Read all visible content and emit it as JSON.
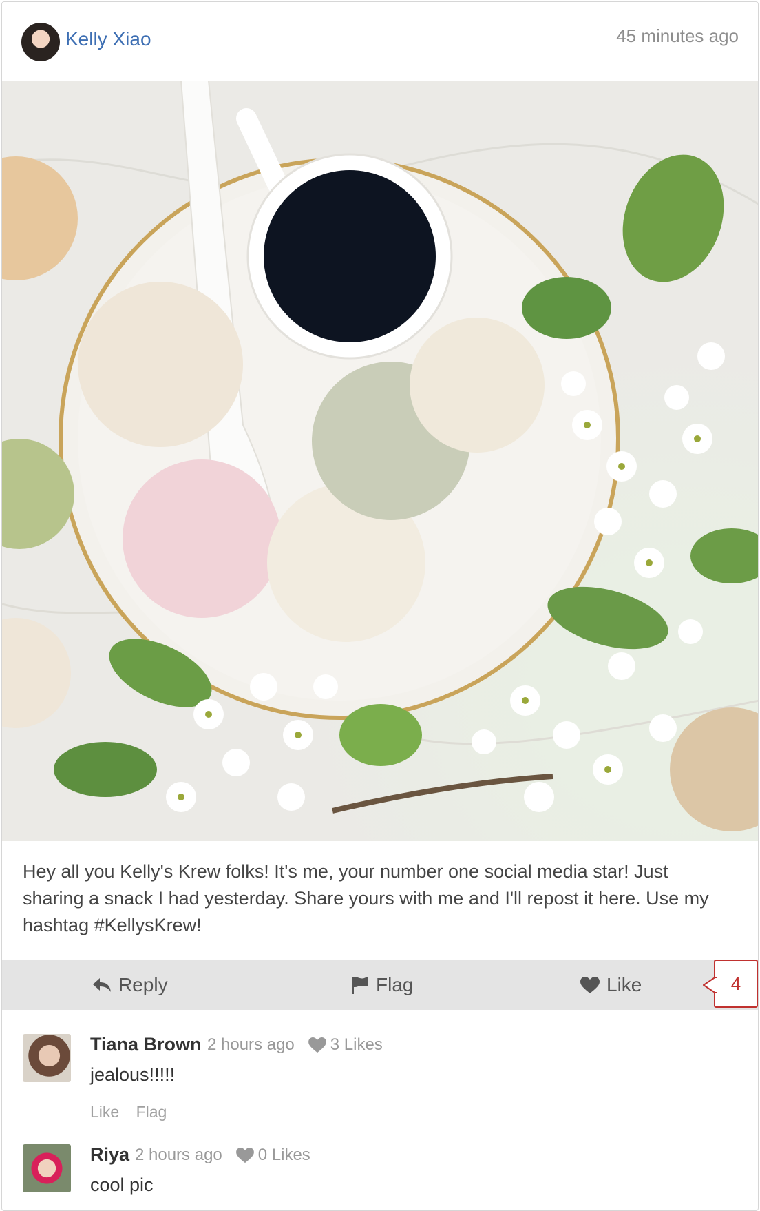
{
  "post": {
    "author": "Kelly Xiao",
    "time": "45 minutes ago",
    "caption": "Hey all you Kelly's Krew folks! It's me, your number one social media star! Just sharing a snack I had yesterday. Share yours with me and I'll repost it here. Use my hashtag #KellysKrew!",
    "actions": {
      "reply": "Reply",
      "flag": "Flag",
      "like": "Like",
      "like_count": "4"
    }
  },
  "comments": [
    {
      "name": "Tiana Brown",
      "time": "2 hours ago",
      "likes": "3 Likes",
      "text": "jealous!!!!!",
      "like_action": "Like",
      "flag_action": "Flag"
    },
    {
      "name": "Riya",
      "time": "2 hours ago",
      "likes": "0 Likes",
      "text": "cool pic"
    }
  ],
  "colors": {
    "link": "#3e6fb3",
    "accent": "#c0312f",
    "action_bar": "#e4e4e4"
  },
  "icons": [
    "reply-icon",
    "flag-icon",
    "heart-icon"
  ]
}
